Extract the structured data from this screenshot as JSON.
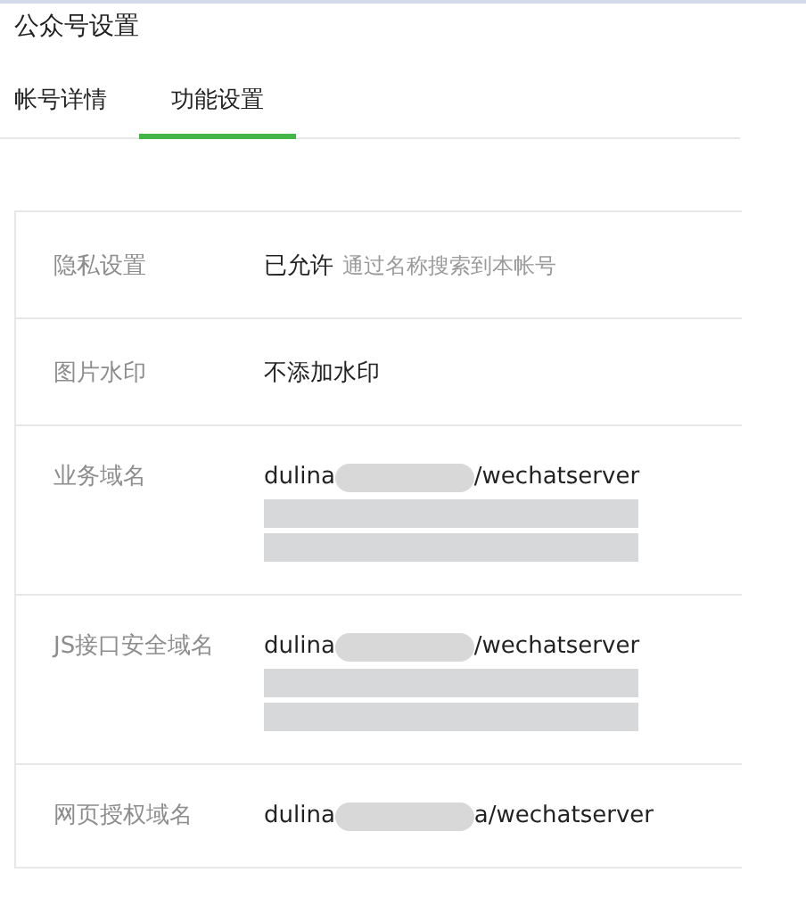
{
  "page_title": "公众号设置",
  "tabs": [
    {
      "label": "帐号详情",
      "selected": false
    },
    {
      "label": "功能设置",
      "selected": true
    }
  ],
  "settings": [
    {
      "kind": "text",
      "label": "隐私设置",
      "value": "已允许",
      "note": "通过名称搜索到本帐号"
    },
    {
      "kind": "text",
      "label": "图片水印",
      "value": "不添加水印"
    },
    {
      "kind": "domain",
      "label": "业务域名",
      "prefix": "dulina",
      "suffix": "/wechatserver",
      "more_redacted": true
    },
    {
      "kind": "domain",
      "label": "JS接口安全域名",
      "prefix": "dulina",
      "suffix": "/wechatserver",
      "more_redacted": true
    },
    {
      "kind": "domain",
      "label": "网页授权域名",
      "prefix": "dulina",
      "suffix": "a/wechatserver",
      "more_redacted": false
    }
  ]
}
